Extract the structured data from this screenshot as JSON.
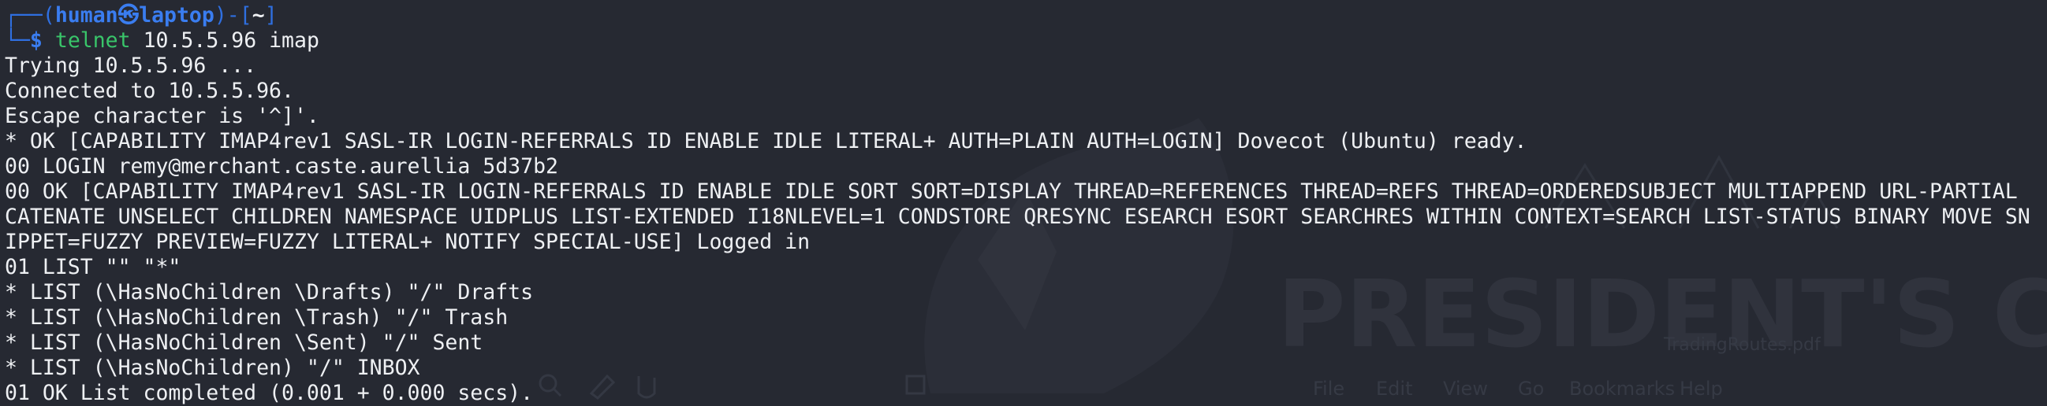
{
  "prompt": {
    "frame_top": "┌──(",
    "user": "human",
    "at_symbol": "㉿",
    "host": "laptop",
    "mid": ")-[",
    "cwd": "~",
    "end": "]",
    "frame_bottom": "└─",
    "dollar": "$",
    "command": "telnet",
    "args": "10.5.5.96 imap"
  },
  "output_lines": [
    "Trying 10.5.5.96 ...",
    "Connected to 10.5.5.96.",
    "Escape character is '^]'.",
    "* OK [CAPABILITY IMAP4rev1 SASL-IR LOGIN-REFERRALS ID ENABLE IDLE LITERAL+ AUTH=PLAIN AUTH=LOGIN] Dovecot (Ubuntu) ready.",
    "00 LOGIN remy@merchant.caste.aurellia 5d37b2",
    "00 OK [CAPABILITY IMAP4rev1 SASL-IR LOGIN-REFERRALS ID ENABLE IDLE SORT SORT=DISPLAY THREAD=REFERENCES THREAD=REFS THREAD=ORDEREDSUBJECT MULTIAPPEND URL-PARTIAL",
    "CATENATE UNSELECT CHILDREN NAMESPACE UIDPLUS LIST-EXTENDED I18NLEVEL=1 CONDSTORE QRESYNC ESEARCH ESORT SEARCHRES WITHIN CONTEXT=SEARCH LIST-STATUS BINARY MOVE SN",
    "IPPET=FUZZY PREVIEW=FUZZY LITERAL+ NOTIFY SPECIAL-USE] Logged in",
    "01 LIST \"\" \"*\"",
    "* LIST (\\HasNoChildren \\Drafts) \"/\" Drafts",
    "* LIST (\\HasNoChildren \\Trash) \"/\" Trash",
    "* LIST (\\HasNoChildren \\Sent) \"/\" Sent",
    "* LIST (\\HasNoChildren) \"/\" INBOX",
    "01 OK List completed (0.001 + 0.000 secs)."
  ],
  "wallpaper": {
    "heading": "PRESIDENT'S CU",
    "filename": "TradingRoutes.pdf",
    "menu": [
      "File",
      "Edit",
      "View",
      "Go",
      "Bookmarks",
      "Help"
    ]
  },
  "colors": {
    "background": "#262932",
    "text": "#eef0f3",
    "prompt_blue": "#3a7df0",
    "command_green": "#39c56a"
  }
}
